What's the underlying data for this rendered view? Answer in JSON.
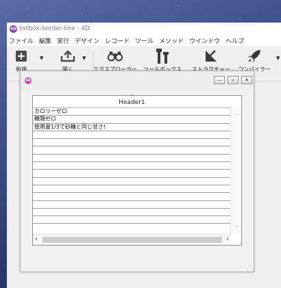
{
  "window": {
    "title": "listbox-border-line - 4D",
    "logo": "4D"
  },
  "menu": [
    "ファイル",
    "編集",
    "実行",
    "デザイン",
    "レコード",
    "ツール",
    "メソッド",
    "ウインドウ",
    "ヘルプ"
  ],
  "toolbar": {
    "new_label": "新規",
    "open_label": "開く",
    "explorer_label": "エクスプローラー",
    "toolbox_label": "ツールボックス",
    "structure_label": "ストラクチャー",
    "compiler_label": "コンパイラー"
  },
  "form": {
    "logo": "4D",
    "listbox": {
      "header": "Header1",
      "rows": [
        "カロリーゼロ",
        "糖類ゼロ",
        "使用量1/3で砂糖と同じ甘さ!",
        "",
        "",
        "",
        "",
        "",
        "",
        "",
        "",
        "",
        "",
        "",
        ""
      ]
    }
  },
  "colors": {
    "accent_logo": "#8b3fb8",
    "form_logo": "#d0439f"
  }
}
